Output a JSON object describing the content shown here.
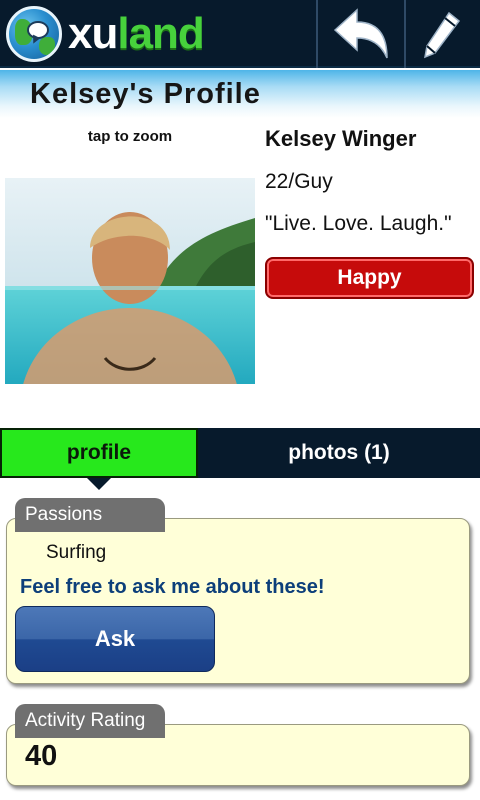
{
  "app": {
    "logo_text_white": "xu",
    "logo_text_green": "land",
    "back_icon": "back-arrow-icon",
    "edit_icon": "pencil-icon"
  },
  "header": {
    "title": "Kelsey's Profile"
  },
  "profile": {
    "zoom_hint": "tap to zoom",
    "name": "Kelsey Winger",
    "age_gender": "22/Guy",
    "quote": "\"Live. Love. Laugh.\"",
    "mood": "Happy"
  },
  "tabs": [
    {
      "label": "profile",
      "active": true
    },
    {
      "label": "photos (1)",
      "active": false
    }
  ],
  "passions": {
    "label": "Passions",
    "items": [
      "Surfing"
    ],
    "prompt": "Feel free to ask me about these!",
    "ask_label": "Ask"
  },
  "activity": {
    "label": "Activity Rating",
    "value": "40"
  },
  "colors": {
    "bar_bg": "#071a2c",
    "tab_active": "#27e81c",
    "mood_red": "#c60b0b",
    "card_bg": "#ffffd8",
    "prompt_blue": "#0d3f7a"
  }
}
